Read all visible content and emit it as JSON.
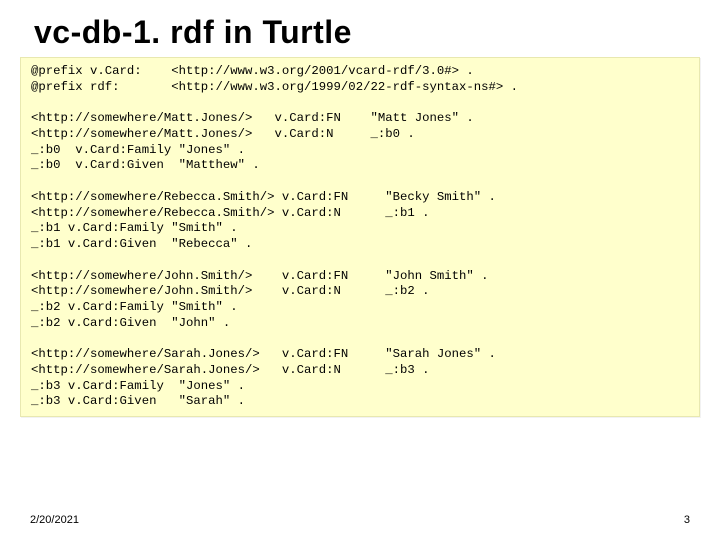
{
  "title": "vc-db-1. rdf in Turtle",
  "code": "@prefix v.Card:    <http://www.w3.org/2001/vcard-rdf/3.0#> .\n@prefix rdf:       <http://www.w3.org/1999/02/22-rdf-syntax-ns#> .\n\n<http://somewhere/Matt.Jones/>   v.Card:FN    \"Matt Jones\" .\n<http://somewhere/Matt.Jones/>   v.Card:N     _:b0 .\n_:b0  v.Card:Family \"Jones\" .\n_:b0  v.Card:Given  \"Matthew\" .\n\n<http://somewhere/Rebecca.Smith/> v.Card:FN     \"Becky Smith\" .\n<http://somewhere/Rebecca.Smith/> v.Card:N      _:b1 .\n_:b1 v.Card:Family \"Smith\" .\n_:b1 v.Card:Given  \"Rebecca\" .\n\n<http://somewhere/John.Smith/>    v.Card:FN     \"John Smith\" .\n<http://somewhere/John.Smith/>    v.Card:N      _:b2 .\n_:b2 v.Card:Family \"Smith\" .\n_:b2 v.Card:Given  \"John\" .\n\n<http://somewhere/Sarah.Jones/>   v.Card:FN     \"Sarah Jones\" .\n<http://somewhere/Sarah.Jones/>   v.Card:N      _:b3 .\n_:b3 v.Card:Family  \"Jones\" .\n_:b3 v.Card:Given   \"Sarah\" .",
  "footer": {
    "date": "2/20/2021",
    "page": "3"
  }
}
